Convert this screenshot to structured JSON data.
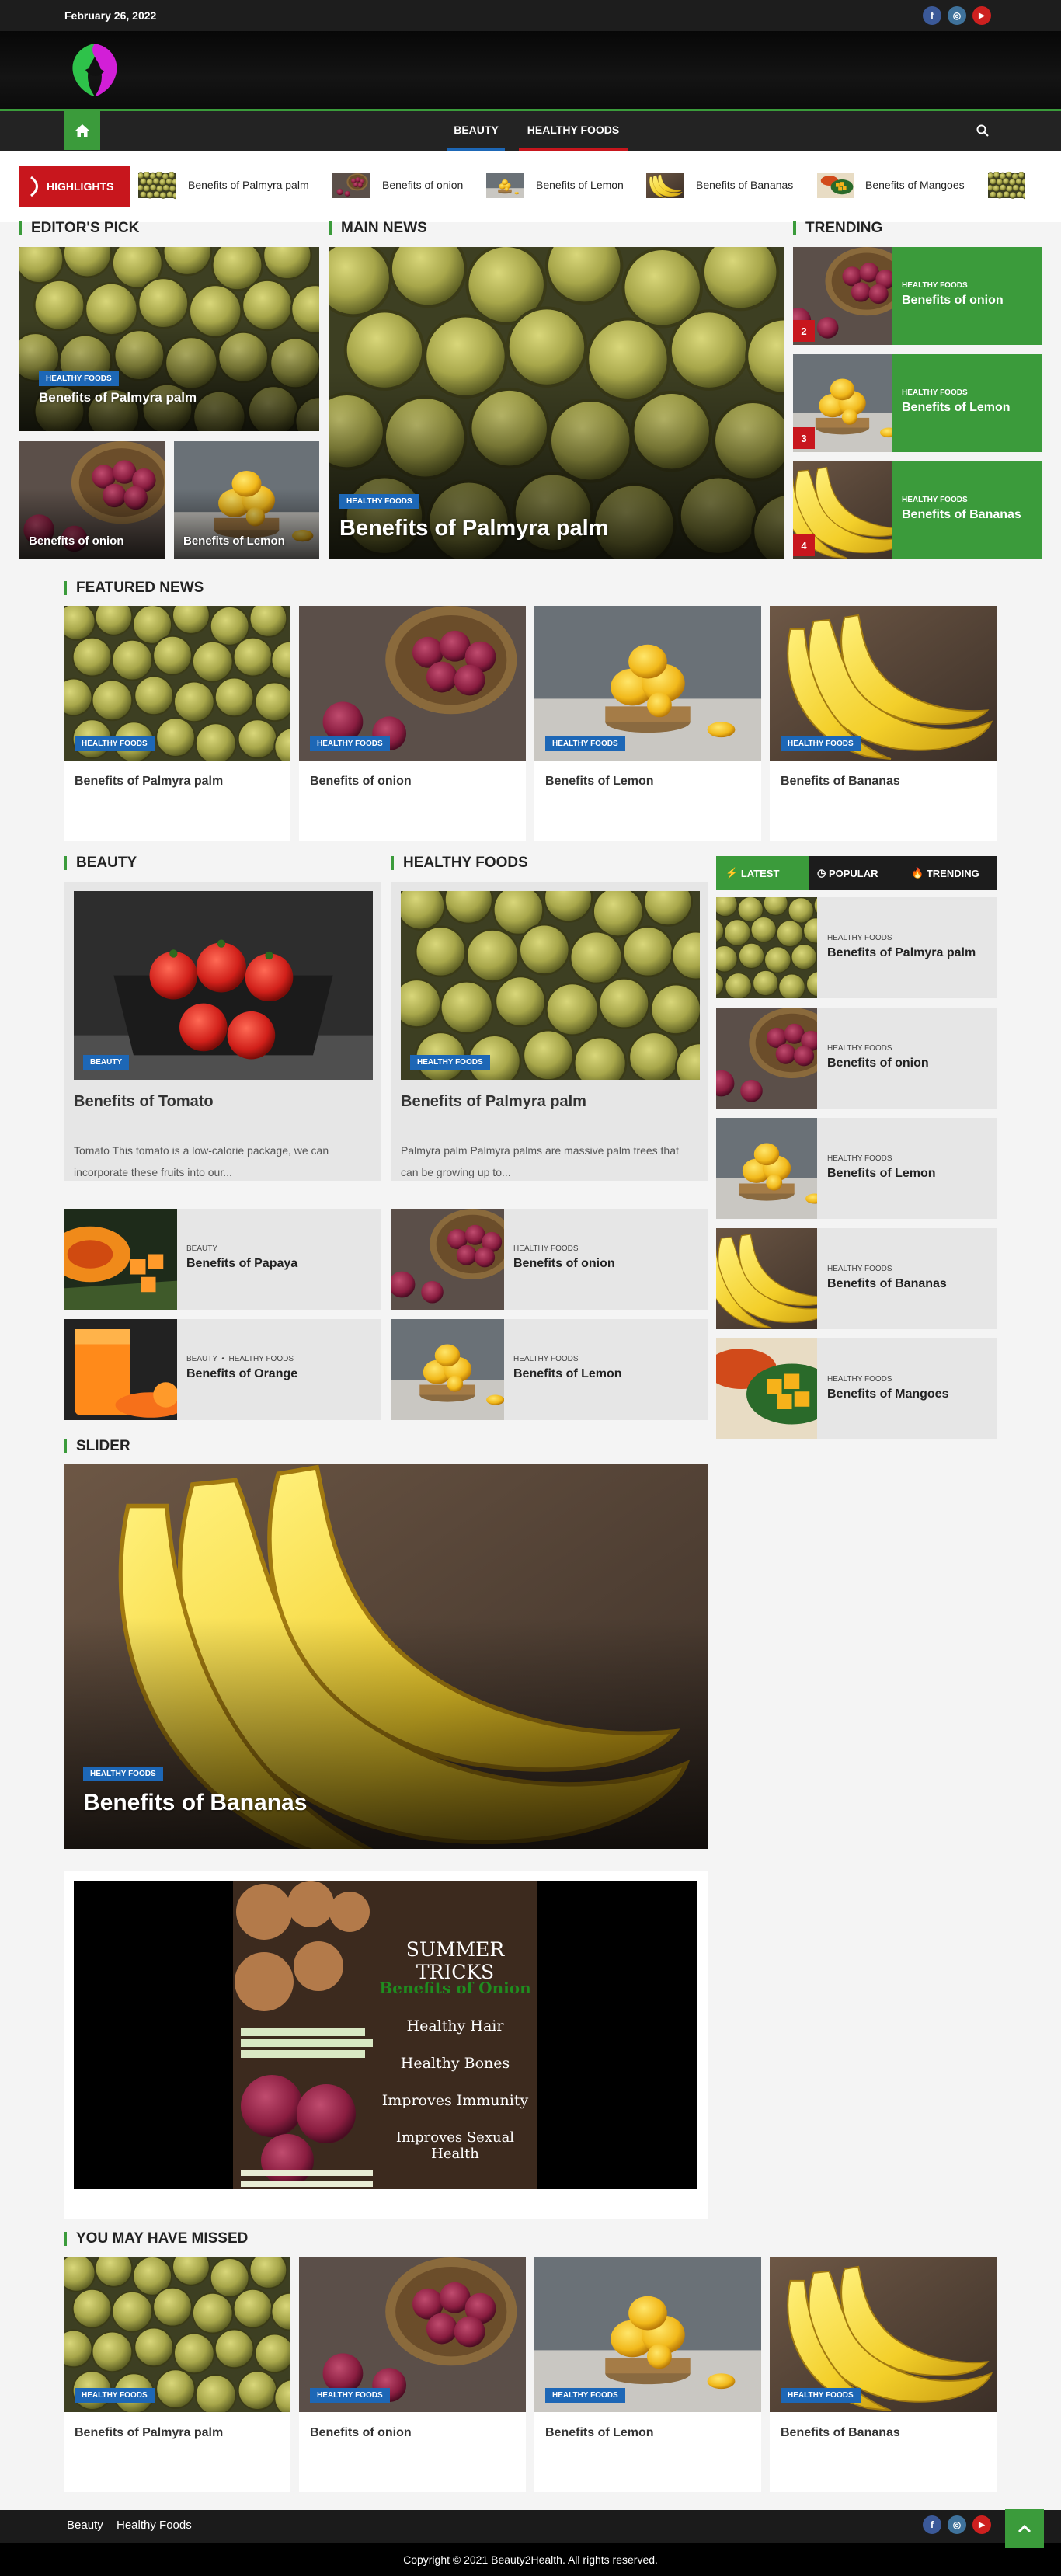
{
  "topbar": {
    "date": "February 26, 2022"
  },
  "social": {
    "facebook": "f",
    "instagram": "◎",
    "youtube": "▶"
  },
  "nav": {
    "items": [
      "BEAUTY",
      "HEALTHY FOODS"
    ]
  },
  "highlights": {
    "label": "HIGHLIGHTS",
    "items": [
      "Benefits of Palmyra palm",
      "Benefits of onion",
      "Benefits of Lemon",
      "Benefits of Bananas",
      "Benefits of Mangoes"
    ]
  },
  "editors_pick": {
    "title": "EDITOR'S PICK",
    "main": {
      "category": "HEALTHY FOODS",
      "title": "Benefits of Palmyra palm"
    },
    "small": [
      {
        "title": "Benefits of onion"
      },
      {
        "title": "Benefits of Lemon"
      }
    ]
  },
  "main_news": {
    "title": "MAIN NEWS",
    "category": "HEALTHY FOODS",
    "headline": "Benefits of Palmyra palm"
  },
  "trending": {
    "title": "TRENDING",
    "items": [
      {
        "num": "2",
        "category": "HEALTHY FOODS",
        "title": "Benefits of onion"
      },
      {
        "num": "3",
        "category": "HEALTHY FOODS",
        "title": "Benefits of Lemon"
      },
      {
        "num": "4",
        "category": "HEALTHY FOODS",
        "title": "Benefits of Bananas"
      }
    ]
  },
  "featured": {
    "title": "FEATURED NEWS",
    "items": [
      {
        "category": "HEALTHY FOODS",
        "title": "Benefits of Palmyra palm"
      },
      {
        "category": "HEALTHY FOODS",
        "title": "Benefits of onion"
      },
      {
        "category": "HEALTHY FOODS",
        "title": "Benefits of Lemon"
      },
      {
        "category": "HEALTHY FOODS",
        "title": "Benefits of Bananas"
      }
    ]
  },
  "beauty": {
    "title": "BEAUTY",
    "main": {
      "category": "BEAUTY",
      "title": "Benefits of Tomato",
      "excerpt": "Tomato This tomato is a low-calorie package, we can incorporate these fruits into our..."
    },
    "list": [
      {
        "category": "BEAUTY",
        "title": "Benefits of Papaya"
      },
      {
        "category": "BEAUTY",
        "category2": "HEALTHY FOODS",
        "title": "Benefits of Orange"
      }
    ]
  },
  "healthy": {
    "title": "HEALTHY FOODS",
    "main": {
      "category": "HEALTHY FOODS",
      "title": "Benefits of Palmyra palm",
      "excerpt": "Palmyra palm Palmyra palms are massive palm trees that can be growing up to..."
    },
    "list": [
      {
        "category": "HEALTHY FOODS",
        "title": "Benefits of onion"
      },
      {
        "category": "HEALTHY FOODS",
        "title": "Benefits of Lemon"
      }
    ]
  },
  "tabs": {
    "latest": "LATEST",
    "popular": "POPULAR",
    "trending": "TRENDING",
    "items": [
      {
        "category": "HEALTHY FOODS",
        "title": "Benefits of Palmyra palm"
      },
      {
        "category": "HEALTHY FOODS",
        "title": "Benefits of onion"
      },
      {
        "category": "HEALTHY FOODS",
        "title": "Benefits of Lemon"
      },
      {
        "category": "HEALTHY FOODS",
        "title": "Benefits of Bananas"
      },
      {
        "category": "HEALTHY FOODS",
        "title": "Benefits of Mangoes"
      }
    ]
  },
  "slider": {
    "title": "SLIDER",
    "category": "HEALTHY FOODS",
    "headline": "Benefits of Bananas"
  },
  "banner": {
    "title": "SUMMER TRICKS",
    "subtitle": "Benefits of Onion",
    "lines": [
      "Healthy Hair",
      "Healthy Bones",
      "Improves Immunity",
      "Improves Sexual Health"
    ]
  },
  "missed": {
    "title": "YOU MAY HAVE MISSED",
    "items": [
      {
        "category": "HEALTHY FOODS",
        "title": "Benefits of Palmyra palm"
      },
      {
        "category": "HEALTHY FOODS",
        "title": "Benefits of onion"
      },
      {
        "category": "HEALTHY FOODS",
        "title": "Benefits of Lemon"
      },
      {
        "category": "HEALTHY FOODS",
        "title": "Benefits of Bananas"
      }
    ]
  },
  "footer": {
    "links": [
      "Beauty",
      "Healthy Foods"
    ],
    "copyright": "Copyright © 2021 Beauty2Health. All rights reserved."
  },
  "colors": {
    "accent": "#3b9b3b",
    "highlight": "#c8161d",
    "badge": "#1d67b6"
  }
}
